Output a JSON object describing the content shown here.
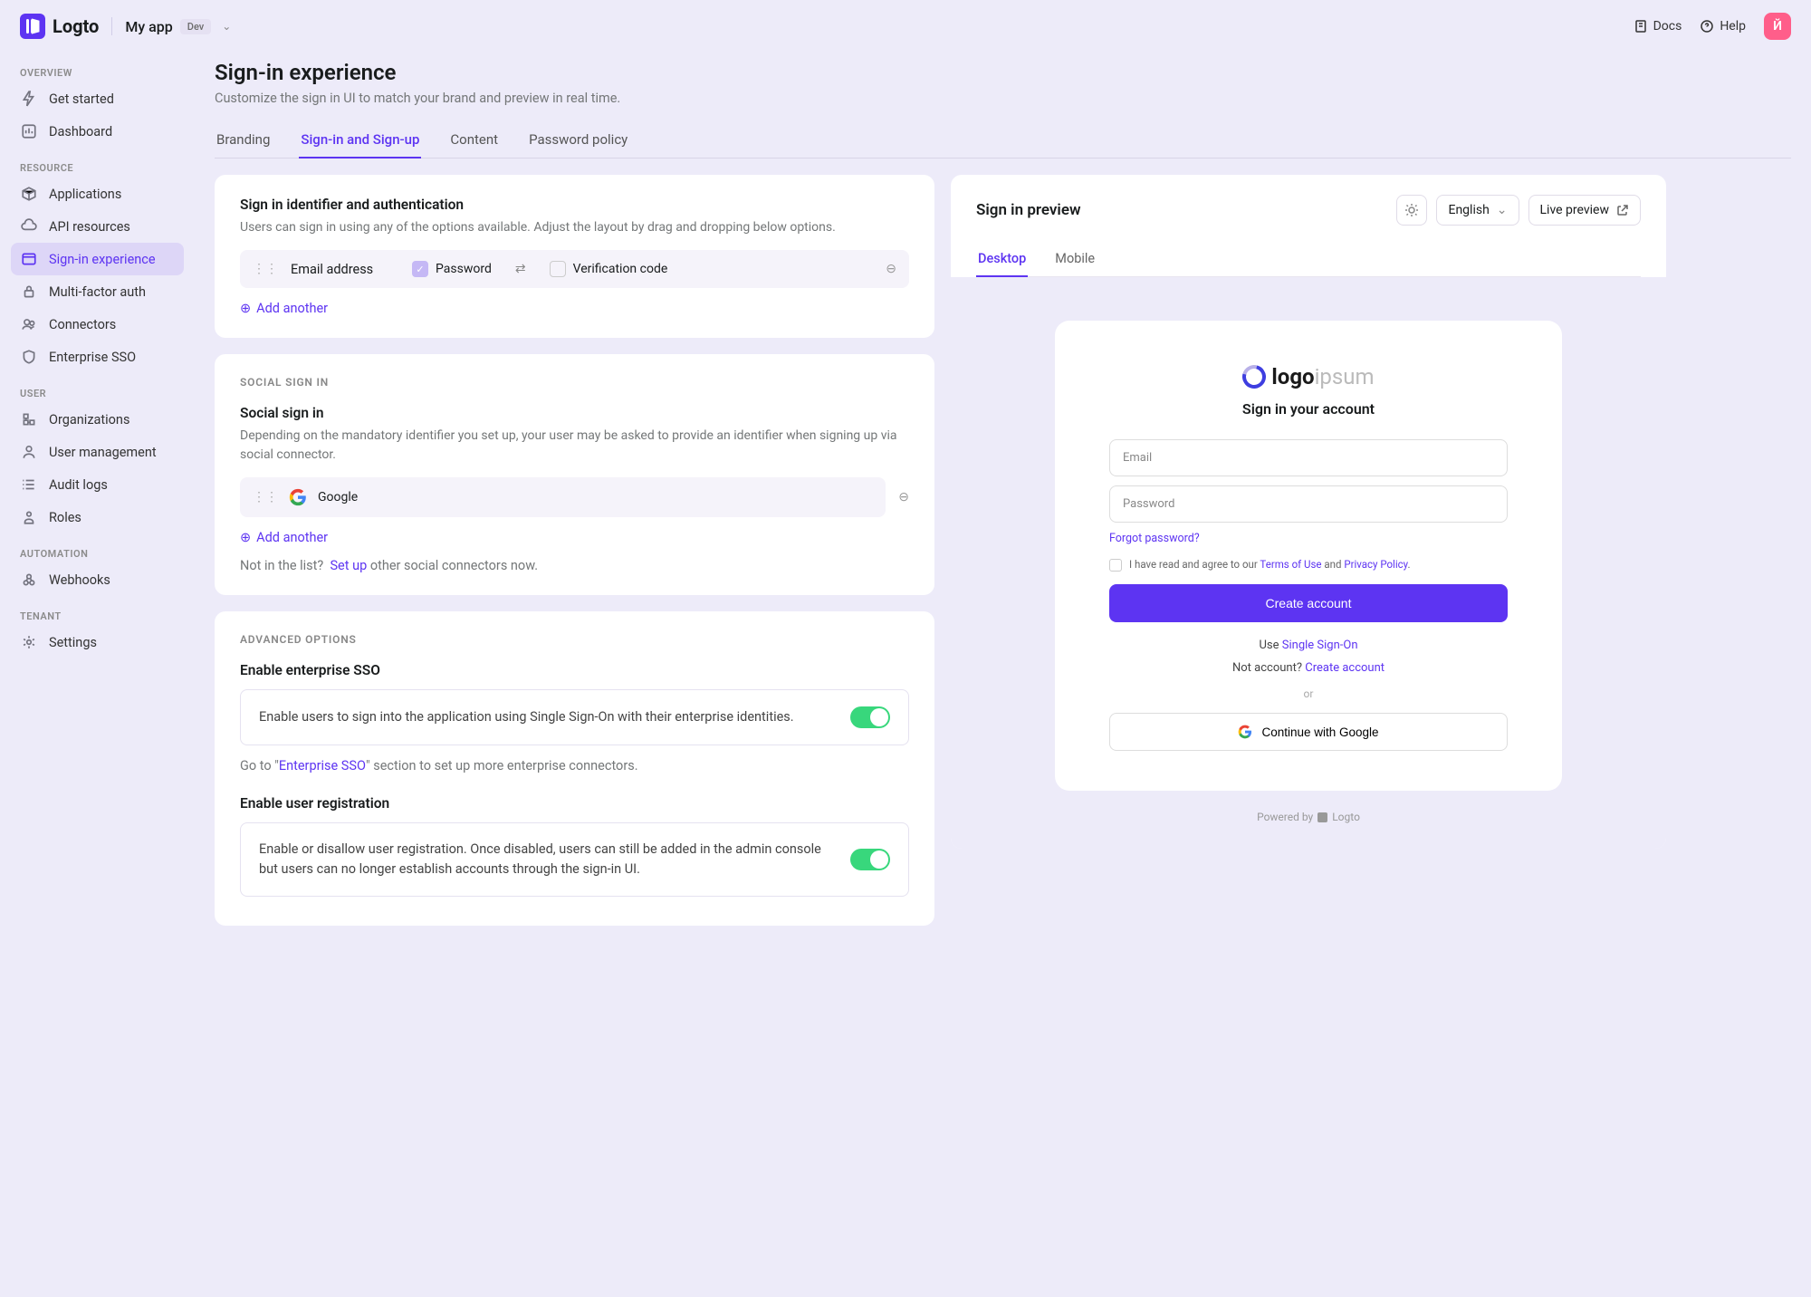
{
  "header": {
    "brand": "Logto",
    "app_name": "My app",
    "badge": "Dev",
    "docs": "Docs",
    "help": "Help",
    "avatar": "Й"
  },
  "sidebar": {
    "sections": [
      {
        "header": "OVERVIEW",
        "items": [
          {
            "label": "Get started",
            "icon": "bolt"
          },
          {
            "label": "Dashboard",
            "icon": "chart"
          }
        ]
      },
      {
        "header": "RESOURCE",
        "items": [
          {
            "label": "Applications",
            "icon": "box"
          },
          {
            "label": "API resources",
            "icon": "cloud"
          },
          {
            "label": "Sign-in experience",
            "icon": "window",
            "active": true
          },
          {
            "label": "Multi-factor auth",
            "icon": "lock"
          },
          {
            "label": "Connectors",
            "icon": "users"
          },
          {
            "label": "Enterprise SSO",
            "icon": "shield"
          }
        ]
      },
      {
        "header": "USER",
        "items": [
          {
            "label": "Organizations",
            "icon": "org"
          },
          {
            "label": "User management",
            "icon": "person"
          },
          {
            "label": "Audit logs",
            "icon": "list"
          },
          {
            "label": "Roles",
            "icon": "role"
          }
        ]
      },
      {
        "header": "AUTOMATION",
        "items": [
          {
            "label": "Webhooks",
            "icon": "webhook"
          }
        ]
      },
      {
        "header": "TENANT",
        "items": [
          {
            "label": "Settings",
            "icon": "gear"
          }
        ]
      }
    ]
  },
  "page": {
    "title": "Sign-in experience",
    "subtitle": "Customize the sign in UI to match your brand and preview in real time.",
    "tabs": [
      "Branding",
      "Sign-in and Sign-up",
      "Content",
      "Password policy"
    ],
    "active_tab": 1
  },
  "signin": {
    "title": "Sign in identifier and authentication",
    "desc": "Users can sign in using any of the options available. Adjust the layout by drag and dropping below options.",
    "identifier": "Email address",
    "password_label": "Password",
    "verification_label": "Verification code",
    "add_another": "Add another"
  },
  "social": {
    "section": "SOCIAL SIGN IN",
    "title": "Social sign in",
    "desc": "Depending on the mandatory identifier you set up, your user may be asked to provide an identifier when signing up via social connector.",
    "provider": "Google",
    "add_another": "Add another",
    "hint_prefix": "Not in the list?",
    "hint_link": "Set up",
    "hint_suffix": "other social connectors now."
  },
  "advanced": {
    "section": "ADVANCED OPTIONS",
    "sso_title": "Enable enterprise SSO",
    "sso_desc": "Enable users to sign into the application using Single Sign-On with their enterprise identities.",
    "sso_hint_prefix": "Go to \"",
    "sso_hint_link": "Enterprise SSO",
    "sso_hint_suffix": "\" section to set up more enterprise connectors.",
    "reg_title": "Enable user registration",
    "reg_desc": "Enable or disallow user registration. Once disabled, users can still be added in the admin console but users can no longer establish accounts through the sign-in UI."
  },
  "preview": {
    "title": "Sign in preview",
    "language": "English",
    "live": "Live preview",
    "tabs": [
      "Desktop",
      "Mobile"
    ],
    "active_tab": 0,
    "mock": {
      "logo_bold": "logo",
      "logo_light": "ipsum",
      "title": "Sign in your account",
      "email_ph": "Email",
      "password_ph": "Password",
      "forgot": "Forgot password?",
      "terms_prefix": "I have read and agree to our",
      "terms_link": "Terms of Use",
      "terms_mid": "and",
      "privacy_link": "Privacy Policy",
      "button": "Create account",
      "sso_prefix": "Use",
      "sso_link": "Single Sign-On",
      "no_account_prefix": "Not account?",
      "no_account_link": "Create account",
      "or": "or",
      "google_btn": "Continue with Google",
      "footer_prefix": "Powered by",
      "footer_brand": "Logto"
    }
  }
}
